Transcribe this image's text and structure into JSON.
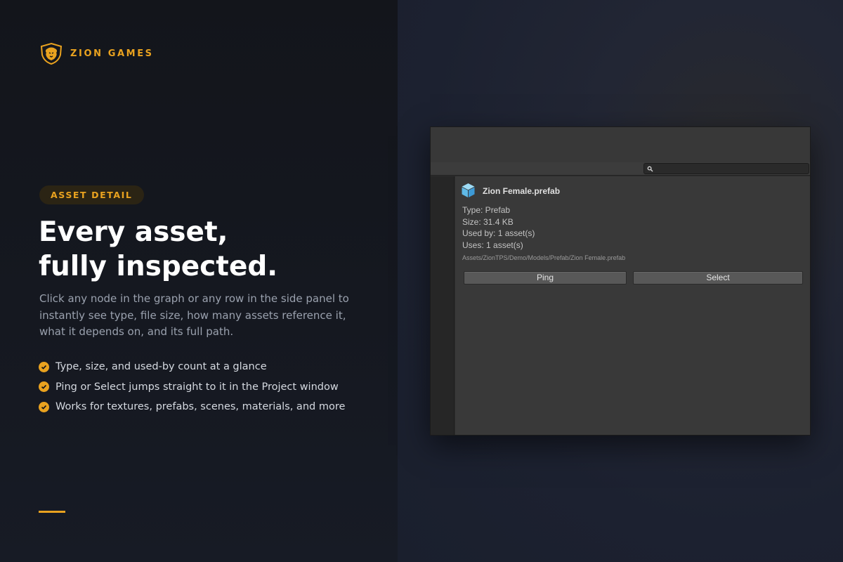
{
  "brand": {
    "name": "ZION GAMES",
    "logo_icon": "lion-shield-icon",
    "accent_color": "#e9a21f"
  },
  "badge": "ASSET DETAIL",
  "headline": {
    "line1": "Every asset,",
    "line2": "fully inspected."
  },
  "description": "Click any node in the graph or any row in the side panel to instantly see type, file size, how many assets reference it, what it depends on, and its full path.",
  "features": [
    {
      "icon": "check-circle-icon",
      "text": "Type, size, and used-by count at a glance"
    },
    {
      "icon": "check-circle-icon",
      "text": "Ping or Select jumps straight to it in the Project window"
    },
    {
      "icon": "check-circle-icon",
      "text": "Works for textures, prefabs, scenes, materials, and more"
    }
  ],
  "editor": {
    "search": {
      "icon": "search-icon",
      "value": ""
    },
    "asset": {
      "icon": "prefab-cube-icon",
      "name": "Zion Female.prefab",
      "type": "Type: Prefab",
      "size": "Size: 31.4 KB",
      "used_by": "Used by: 1 asset(s)",
      "uses": "Uses: 1 asset(s)",
      "path": "Assets/ZionTPS/Demo/Models/Prefab/Zion Female.prefab"
    },
    "buttons": {
      "ping": "Ping",
      "select": "Select"
    }
  }
}
